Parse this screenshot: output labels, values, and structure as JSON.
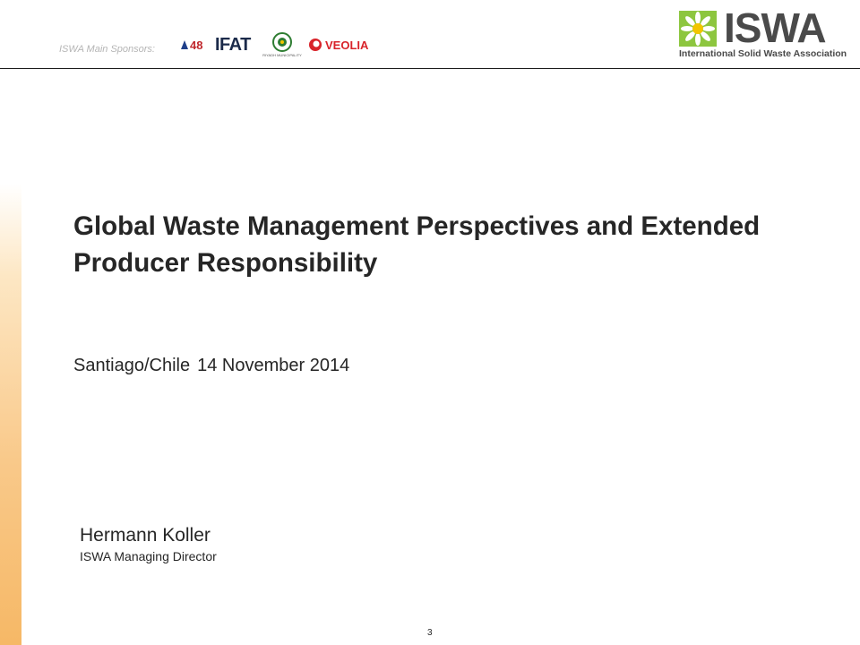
{
  "header": {
    "sponsors_label": "ISWA Main Sponsors:",
    "sponsors": [
      {
        "id": "48",
        "text": "48"
      },
      {
        "id": "ifat",
        "text": "IFAT"
      },
      {
        "id": "riyadh",
        "text": "RIYADH MUNICIPALITY"
      },
      {
        "id": "veolia",
        "text": "VEOLIA"
      }
    ],
    "logo": {
      "word": "ISWA",
      "subtitle": "International Solid Waste Association",
      "colors": {
        "green": "#8dc63f",
        "yellow": "#f2c500",
        "gray": "#4a4a4a"
      }
    }
  },
  "slide": {
    "title": "Global Waste Management Perspectives and Extended Producer Responsibility",
    "location": "Santiago/Chile",
    "date": "14 November 2014",
    "presenter": {
      "name": "Hermann Koller",
      "role": "ISWA  Managing Director"
    },
    "page_number": "3"
  },
  "colors": {
    "text": "#262626",
    "accent_bar": "#f6b866",
    "sponsors_label": "#b5b5b5"
  }
}
